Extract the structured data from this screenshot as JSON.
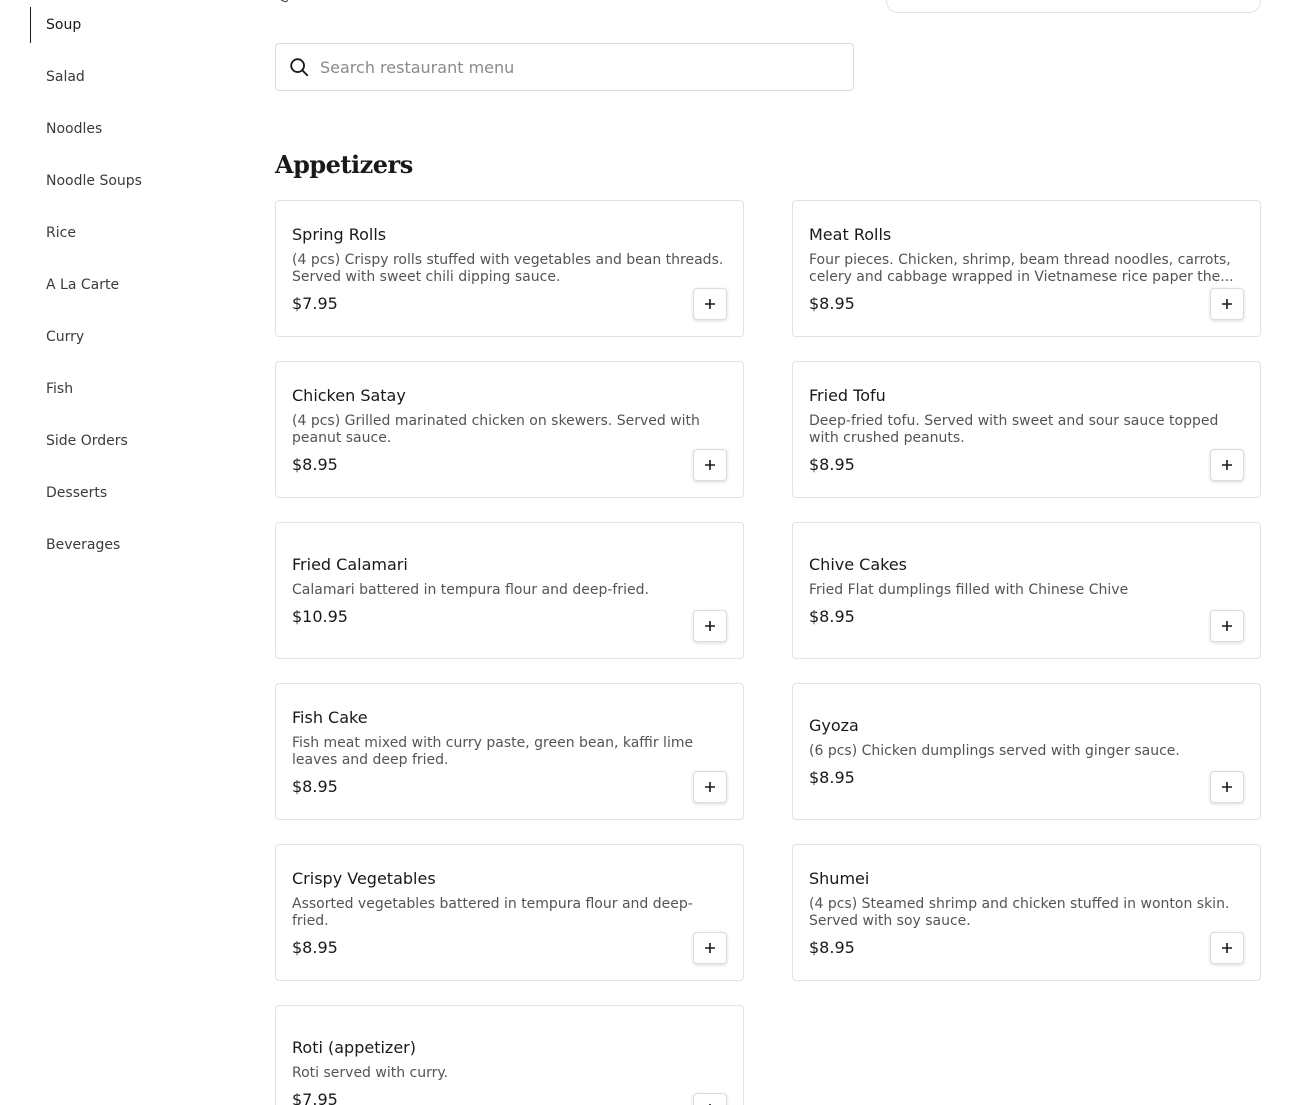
{
  "sidebar": {
    "items": [
      {
        "label": "Soup"
      },
      {
        "label": "Salad"
      },
      {
        "label": "Noodles"
      },
      {
        "label": "Noodle Soups"
      },
      {
        "label": "Rice"
      },
      {
        "label": "A La Carte"
      },
      {
        "label": "Curry"
      },
      {
        "label": "Fish"
      },
      {
        "label": "Side Orders"
      },
      {
        "label": "Desserts"
      },
      {
        "label": "Beverages"
      }
    ]
  },
  "search": {
    "placeholder": "Search restaurant menu"
  },
  "section": {
    "title": "Appetizers"
  },
  "items": [
    {
      "name": "Spring Rolls",
      "desc": "(4 pcs) Crispy rolls stuffed with vegetables and bean threads. Served with sweet chili dipping sauce.",
      "price": "$7.95"
    },
    {
      "name": "Meat Rolls",
      "desc": "Four pieces. Chicken, shrimp, beam thread noodles, carrots, celery and cabbage wrapped in Vietnamese rice paper the...",
      "price": "$8.95"
    },
    {
      "name": "Chicken Satay",
      "desc": "(4 pcs) Grilled marinated chicken on skewers. Served with peanut sauce.",
      "price": "$8.95"
    },
    {
      "name": "Fried Tofu",
      "desc": "Deep-fried tofu. Served with sweet and sour sauce topped with crushed peanuts.",
      "price": "$8.95"
    },
    {
      "name": "Fried Calamari",
      "desc": "Calamari battered in tempura flour and deep-fried.",
      "price": "$10.95"
    },
    {
      "name": "Chive Cakes",
      "desc": "Fried Flat dumplings filled with Chinese Chive",
      "price": "$8.95"
    },
    {
      "name": "Fish Cake",
      "desc": "Fish meat mixed with curry paste, green bean, kaffir lime leaves and deep fried.",
      "price": "$8.95"
    },
    {
      "name": "Gyoza",
      "desc": "(6 pcs) Chicken dumplings served with ginger sauce.",
      "price": "$8.95"
    },
    {
      "name": "Crispy Vegetables",
      "desc": "Assorted vegetables battered in tempura flour and deep-fried.",
      "price": "$8.95"
    },
    {
      "name": "Shumei",
      "desc": "(4 pcs) Steamed shrimp and chicken stuffed in wonton skin. Served with soy sauce.",
      "price": "$8.95"
    },
    {
      "name": "Roti (appetizer)",
      "desc": "Roti served with curry.",
      "price": "$7.95"
    }
  ]
}
